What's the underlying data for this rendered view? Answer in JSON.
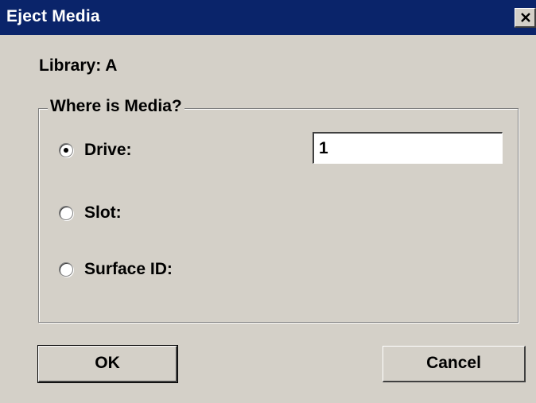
{
  "window": {
    "title": "Eject Media",
    "close_label": "close"
  },
  "library": {
    "label": "Library: A"
  },
  "group": {
    "legend": "Where is Media?",
    "options": [
      {
        "label": "Drive:",
        "selected": true
      },
      {
        "label": "Slot:",
        "selected": false
      },
      {
        "label": "Surface ID:",
        "selected": false
      }
    ],
    "drive_value": "1"
  },
  "buttons": {
    "ok_label": "OK",
    "cancel_label": "Cancel"
  },
  "colors": {
    "titlebar": "#0a246a",
    "face": "#d4d0c8"
  },
  "icons": {
    "close": "close-icon",
    "radio": "radio-button"
  }
}
